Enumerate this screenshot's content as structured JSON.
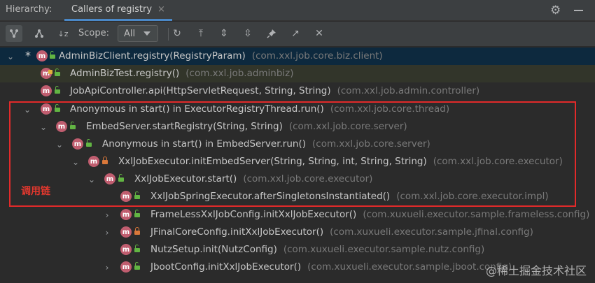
{
  "tabbar": {
    "hierarchy_label": "Hierarchy:",
    "active_tab_label": "Callers of registry",
    "close_glyph": "×",
    "settings_icon": "gear-icon",
    "minimize_icon": "minimize-icon"
  },
  "toolbar": {
    "scope_label": "Scope:",
    "scope_value": "All",
    "buttons": [
      {
        "icon": "callers-hierarchy-icon",
        "glyph": "⑂",
        "active": true
      },
      {
        "icon": "callees-hierarchy-icon",
        "glyph": "⑃",
        "active": false
      },
      {
        "icon": "sort-alphabetically-icon",
        "glyph": "↓z",
        "active": false
      },
      {
        "icon": "refresh-icon",
        "glyph": "↻",
        "active": false
      },
      {
        "icon": "export-icon",
        "glyph": "⤒",
        "active": false
      },
      {
        "icon": "expand-all-icon",
        "glyph": "⇕",
        "active": false
      },
      {
        "icon": "collapse-all-icon",
        "glyph": "⇳",
        "active": false
      },
      {
        "icon": "pin-icon",
        "glyph": "📌",
        "active": false
      },
      {
        "icon": "navigate-icon",
        "glyph": "↗",
        "active": false
      },
      {
        "icon": "close-icon",
        "glyph": "✕",
        "active": false
      }
    ]
  },
  "tree": [
    {
      "method": "AdminBizClient.registry(RegistryParam)",
      "package": "(com.xxl.job.core.biz.client)",
      "arrow": "⌄",
      "star": "*",
      "visibility": "public"
    },
    {
      "method": "AdminBizTest.registry()",
      "package": "(com.xxl.job.adminbiz)",
      "arrow": "",
      "visibility": "public"
    },
    {
      "method": "JobApiController.api(HttpServletRequest, String, String)",
      "package": "(com.xxl.job.admin.controller)",
      "arrow": "",
      "visibility": "public"
    },
    {
      "method": "Anonymous in start() in ExecutorRegistryThread.run()",
      "package": "(com.xxl.job.core.thread)",
      "arrow": "⌄",
      "visibility": "public"
    },
    {
      "method": "EmbedServer.startRegistry(String, String)",
      "package": "(com.xxl.job.core.server)",
      "arrow": "⌄",
      "visibility": "public"
    },
    {
      "method": "Anonymous in start() in EmbedServer.run()",
      "package": "(com.xxl.job.core.server)",
      "arrow": "⌄",
      "visibility": "public"
    },
    {
      "method": "XxlJobExecutor.initEmbedServer(String, String, int, String, String)",
      "package": "(com.xxl.job.core.executor)",
      "arrow": "⌄",
      "visibility": "private"
    },
    {
      "method": "XxlJobExecutor.start()",
      "package": "(com.xxl.job.core.executor)",
      "arrow": "⌄",
      "visibility": "public"
    },
    {
      "method": "XxlJobSpringExecutor.afterSingletonsInstantiated()",
      "package": "(com.xxl.job.core.executor.impl)",
      "arrow": "",
      "visibility": "public"
    },
    {
      "method": "FrameLessXxlJobConfig.initXxlJobExecutor()",
      "package": "(com.xuxueli.executor.sample.frameless.config)",
      "arrow": "›",
      "visibility": "public"
    },
    {
      "method": "JFinalCoreConfig.initXxlJobExecutor()",
      "package": "(com.xuxueli.executor.sample.jfinal.config)",
      "arrow": "›",
      "visibility": "private"
    },
    {
      "method": "NutzSetup.init(NutzConfig)",
      "package": "(com.xuxueli.executor.sample.nutz.config)",
      "arrow": "",
      "visibility": "public"
    },
    {
      "method": "JbootConfig.initXxlJobExecutor()",
      "package": "(com.xuxueli.executor.sample.jboot.config)",
      "arrow": "›",
      "visibility": "public"
    }
  ],
  "annotation": "调用链",
  "watermark": "@稀土掘金技术社区",
  "colors": {
    "selection": "#0d293e",
    "highlight_row": "#32352a",
    "method_icon": "#c05d6f",
    "annotation_red": "#e22a2a"
  }
}
